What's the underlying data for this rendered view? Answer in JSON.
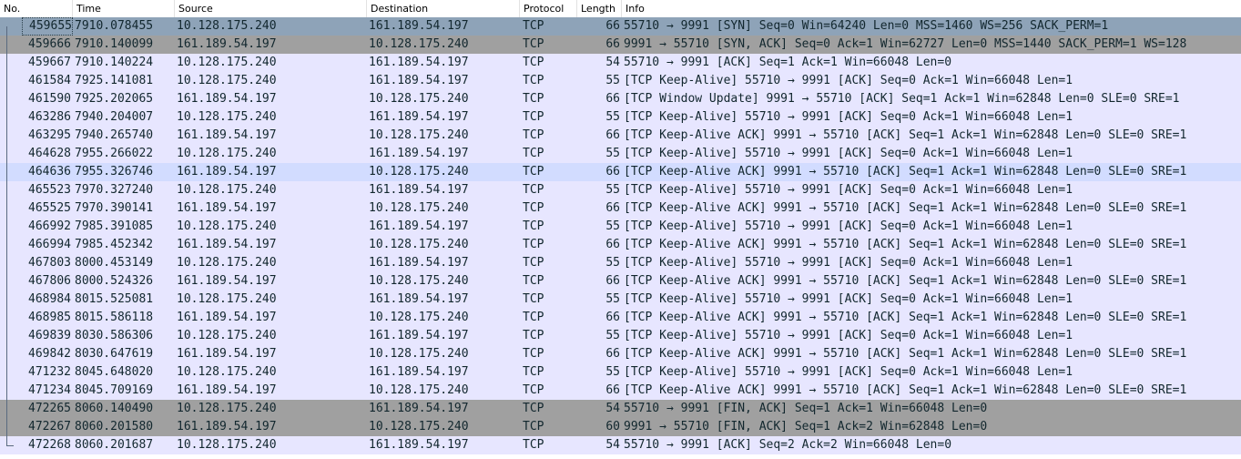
{
  "columns": {
    "no": "No.",
    "time": "Time",
    "source": "Source",
    "destination": "Destination",
    "protocol": "Protocol",
    "length": "Length",
    "info": "Info"
  },
  "colors": {
    "selected": "#8ea3b8",
    "related": "#a0a0a0",
    "normal": "#e7e6ff",
    "highlight": "#d2dcff"
  },
  "rows": [
    {
      "no": "459655",
      "time": "7910.078455",
      "src": "10.128.175.240",
      "dst": "161.189.54.197",
      "proto": "TCP",
      "len": "66",
      "info": "55710 → 9991 [SYN] Seq=0 Win=64240 Len=0 MSS=1460 WS=256 SACK_PERM=1",
      "style": "selected"
    },
    {
      "no": "459666",
      "time": "7910.140099",
      "src": "161.189.54.197",
      "dst": "10.128.175.240",
      "proto": "TCP",
      "len": "66",
      "info": "9991 → 55710 [SYN, ACK] Seq=0 Ack=1 Win=62727 Len=0 MSS=1440 SACK_PERM=1 WS=128",
      "style": "related"
    },
    {
      "no": "459667",
      "time": "7910.140224",
      "src": "10.128.175.240",
      "dst": "161.189.54.197",
      "proto": "TCP",
      "len": "54",
      "info": "55710 → 9991 [ACK] Seq=1 Ack=1 Win=66048 Len=0",
      "style": "normal"
    },
    {
      "no": "461584",
      "time": "7925.141081",
      "src": "10.128.175.240",
      "dst": "161.189.54.197",
      "proto": "TCP",
      "len": "55",
      "info": "[TCP Keep-Alive] 55710 → 9991 [ACK] Seq=0 Ack=1 Win=66048 Len=1",
      "style": "normal"
    },
    {
      "no": "461590",
      "time": "7925.202065",
      "src": "161.189.54.197",
      "dst": "10.128.175.240",
      "proto": "TCP",
      "len": "66",
      "info": "[TCP Window Update] 9991 → 55710 [ACK] Seq=1 Ack=1 Win=62848 Len=0 SLE=0 SRE=1",
      "style": "normal"
    },
    {
      "no": "463286",
      "time": "7940.204007",
      "src": "10.128.175.240",
      "dst": "161.189.54.197",
      "proto": "TCP",
      "len": "55",
      "info": "[TCP Keep-Alive] 55710 → 9991 [ACK] Seq=0 Ack=1 Win=66048 Len=1",
      "style": "normal"
    },
    {
      "no": "463295",
      "time": "7940.265740",
      "src": "161.189.54.197",
      "dst": "10.128.175.240",
      "proto": "TCP",
      "len": "66",
      "info": "[TCP Keep-Alive ACK] 9991 → 55710 [ACK] Seq=1 Ack=1 Win=62848 Len=0 SLE=0 SRE=1",
      "style": "normal"
    },
    {
      "no": "464628",
      "time": "7955.266022",
      "src": "10.128.175.240",
      "dst": "161.189.54.197",
      "proto": "TCP",
      "len": "55",
      "info": "[TCP Keep-Alive] 55710 → 9991 [ACK] Seq=0 Ack=1 Win=66048 Len=1",
      "style": "normal"
    },
    {
      "no": "464636",
      "time": "7955.326746",
      "src": "161.189.54.197",
      "dst": "10.128.175.240",
      "proto": "TCP",
      "len": "66",
      "info": "[TCP Keep-Alive ACK] 9991 → 55710 [ACK] Seq=1 Ack=1 Win=62848 Len=0 SLE=0 SRE=1",
      "style": "highlight"
    },
    {
      "no": "465523",
      "time": "7970.327240",
      "src": "10.128.175.240",
      "dst": "161.189.54.197",
      "proto": "TCP",
      "len": "55",
      "info": "[TCP Keep-Alive] 55710 → 9991 [ACK] Seq=0 Ack=1 Win=66048 Len=1",
      "style": "normal"
    },
    {
      "no": "465525",
      "time": "7970.390141",
      "src": "161.189.54.197",
      "dst": "10.128.175.240",
      "proto": "TCP",
      "len": "66",
      "info": "[TCP Keep-Alive ACK] 9991 → 55710 [ACK] Seq=1 Ack=1 Win=62848 Len=0 SLE=0 SRE=1",
      "style": "normal"
    },
    {
      "no": "466992",
      "time": "7985.391085",
      "src": "10.128.175.240",
      "dst": "161.189.54.197",
      "proto": "TCP",
      "len": "55",
      "info": "[TCP Keep-Alive] 55710 → 9991 [ACK] Seq=0 Ack=1 Win=66048 Len=1",
      "style": "normal"
    },
    {
      "no": "466994",
      "time": "7985.452342",
      "src": "161.189.54.197",
      "dst": "10.128.175.240",
      "proto": "TCP",
      "len": "66",
      "info": "[TCP Keep-Alive ACK] 9991 → 55710 [ACK] Seq=1 Ack=1 Win=62848 Len=0 SLE=0 SRE=1",
      "style": "normal"
    },
    {
      "no": "467803",
      "time": "8000.453149",
      "src": "10.128.175.240",
      "dst": "161.189.54.197",
      "proto": "TCP",
      "len": "55",
      "info": "[TCP Keep-Alive] 55710 → 9991 [ACK] Seq=0 Ack=1 Win=66048 Len=1",
      "style": "normal"
    },
    {
      "no": "467806",
      "time": "8000.524326",
      "src": "161.189.54.197",
      "dst": "10.128.175.240",
      "proto": "TCP",
      "len": "66",
      "info": "[TCP Keep-Alive ACK] 9991 → 55710 [ACK] Seq=1 Ack=1 Win=62848 Len=0 SLE=0 SRE=1",
      "style": "normal"
    },
    {
      "no": "468984",
      "time": "8015.525081",
      "src": "10.128.175.240",
      "dst": "161.189.54.197",
      "proto": "TCP",
      "len": "55",
      "info": "[TCP Keep-Alive] 55710 → 9991 [ACK] Seq=0 Ack=1 Win=66048 Len=1",
      "style": "normal"
    },
    {
      "no": "468985",
      "time": "8015.586118",
      "src": "161.189.54.197",
      "dst": "10.128.175.240",
      "proto": "TCP",
      "len": "66",
      "info": "[TCP Keep-Alive ACK] 9991 → 55710 [ACK] Seq=1 Ack=1 Win=62848 Len=0 SLE=0 SRE=1",
      "style": "normal"
    },
    {
      "no": "469839",
      "time": "8030.586306",
      "src": "10.128.175.240",
      "dst": "161.189.54.197",
      "proto": "TCP",
      "len": "55",
      "info": "[TCP Keep-Alive] 55710 → 9991 [ACK] Seq=0 Ack=1 Win=66048 Len=1",
      "style": "normal"
    },
    {
      "no": "469842",
      "time": "8030.647619",
      "src": "161.189.54.197",
      "dst": "10.128.175.240",
      "proto": "TCP",
      "len": "66",
      "info": "[TCP Keep-Alive ACK] 9991 → 55710 [ACK] Seq=1 Ack=1 Win=62848 Len=0 SLE=0 SRE=1",
      "style": "normal"
    },
    {
      "no": "471232",
      "time": "8045.648020",
      "src": "10.128.175.240",
      "dst": "161.189.54.197",
      "proto": "TCP",
      "len": "55",
      "info": "[TCP Keep-Alive] 55710 → 9991 [ACK] Seq=0 Ack=1 Win=66048 Len=1",
      "style": "normal"
    },
    {
      "no": "471234",
      "time": "8045.709169",
      "src": "161.189.54.197",
      "dst": "10.128.175.240",
      "proto": "TCP",
      "len": "66",
      "info": "[TCP Keep-Alive ACK] 9991 → 55710 [ACK] Seq=1 Ack=1 Win=62848 Len=0 SLE=0 SRE=1",
      "style": "normal"
    },
    {
      "no": "472265",
      "time": "8060.140490",
      "src": "10.128.175.240",
      "dst": "161.189.54.197",
      "proto": "TCP",
      "len": "54",
      "info": "55710 → 9991 [FIN, ACK] Seq=1 Ack=1 Win=66048 Len=0",
      "style": "related"
    },
    {
      "no": "472267",
      "time": "8060.201580",
      "src": "161.189.54.197",
      "dst": "10.128.175.240",
      "proto": "TCP",
      "len": "60",
      "info": "9991 → 55710 [FIN, ACK] Seq=1 Ack=2 Win=62848 Len=0",
      "style": "related"
    },
    {
      "no": "472268",
      "time": "8060.201687",
      "src": "10.128.175.240",
      "dst": "161.189.54.197",
      "proto": "TCP",
      "len": "54",
      "info": "55710 → 9991 [ACK] Seq=2 Ack=2 Win=66048 Len=0",
      "style": "normal"
    }
  ]
}
